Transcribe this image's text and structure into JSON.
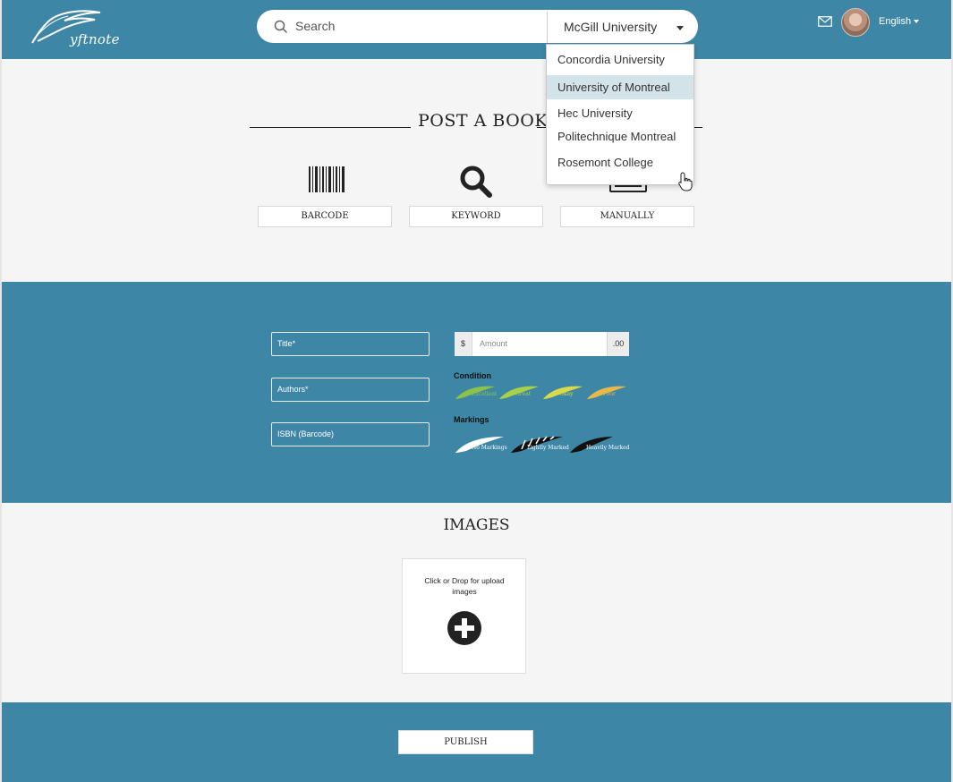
{
  "header": {
    "logo_text": "yftnote",
    "search_placeholder": "Search",
    "university_selected": "McGill University",
    "language": "English"
  },
  "dropdown": {
    "options": [
      "Concordia University",
      "University of Montreal",
      "Hec University",
      "Politechnique Montreal",
      "Rosemont College"
    ],
    "highlighted": "University of Montreal"
  },
  "post_section": {
    "title": "POST A BOOK",
    "methods": [
      {
        "label": "BARCODE",
        "icon": "barcode-icon"
      },
      {
        "label": "KEYWORD",
        "icon": "magnifier-icon"
      },
      {
        "label": "MANUALLY",
        "icon": "keyboard-icon"
      }
    ]
  },
  "form": {
    "title_placeholder": "Title*",
    "authors_placeholder": "Authors*",
    "isbn_placeholder": "ISBN (Barcode)",
    "amount_prefix": "$",
    "amount_placeholder": "Amount",
    "amount_suffix": ".00",
    "condition_label": "Condition",
    "conditions": [
      "Excellent",
      "Great",
      "Okay",
      "Poor"
    ],
    "markings_label": "Markings",
    "markings": [
      "No Markings",
      "Lightly Marked",
      "Heavily Marked"
    ]
  },
  "images": {
    "title": "IMAGES",
    "upload_text": "Click or Drop for upload images"
  },
  "publish": {
    "label": "PUBLISH"
  },
  "colors": {
    "brand_teal": "#3d86a6",
    "section_bg": "#f5f5f5",
    "dropdown_highlight": "#d2e4ea",
    "condition_excellent": "#8bc34a",
    "condition_great": "#a8d04a",
    "condition_okay": "#d9d94a",
    "condition_poor": "#e8b84a"
  }
}
